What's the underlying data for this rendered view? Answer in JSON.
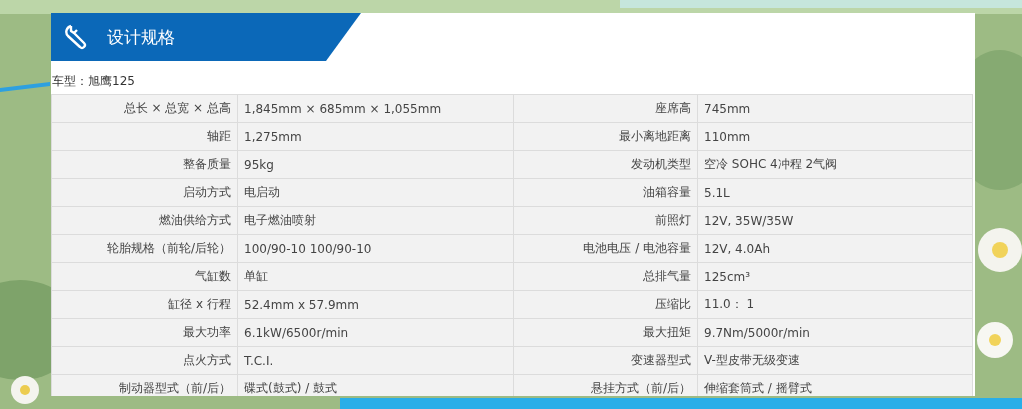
{
  "header": {
    "title": "设计规格"
  },
  "model_line": "车型：旭鹰125",
  "spec_rows": [
    [
      {
        "label": "总长 × 总宽 × 总高",
        "value": "1,845mm × 685mm × 1,055mm"
      },
      {
        "label": "座席高",
        "value": "745mm"
      }
    ],
    [
      {
        "label": "轴距",
        "value": "1,275mm"
      },
      {
        "label": "最小离地距离",
        "value": "110mm"
      }
    ],
    [
      {
        "label": "整备质量",
        "value": "95kg"
      },
      {
        "label": "发动机类型",
        "value": "空冷 SOHC 4冲程 2气阀"
      }
    ],
    [
      {
        "label": "启动方式",
        "value": "电启动"
      },
      {
        "label": "油箱容量",
        "value": "5.1L"
      }
    ],
    [
      {
        "label": "燃油供给方式",
        "value": "电子燃油喷射"
      },
      {
        "label": "前照灯",
        "value": "12V, 35W/35W"
      }
    ],
    [
      {
        "label": "轮胎规格（前轮/后轮）",
        "value": "100/90-10 100/90-10"
      },
      {
        "label": "电池电压 / 电池容量",
        "value": "12V, 4.0Ah"
      }
    ],
    [
      {
        "label": "气缸数",
        "value": "单缸"
      },
      {
        "label": "总排气量",
        "value": "125cm³"
      }
    ],
    [
      {
        "label": "缸径 x 行程",
        "value": "52.4mm x 57.9mm"
      },
      {
        "label": "压缩比",
        "value": "11.0： 1"
      }
    ],
    [
      {
        "label": "最大功率",
        "value": "6.1kW/6500r/min"
      },
      {
        "label": "最大扭矩",
        "value": "9.7Nm/5000r/min"
      }
    ],
    [
      {
        "label": "点火方式",
        "value": "T.C.I."
      },
      {
        "label": "变速器型式",
        "value": "V-型皮带无级变速"
      }
    ],
    [
      {
        "label": "制动器型式（前/后）",
        "value": "碟式(鼓式) / 鼓式"
      },
      {
        "label": "悬挂方式（前/后）",
        "value": "伸缩套筒式 / 摇臂式"
      }
    ]
  ]
}
